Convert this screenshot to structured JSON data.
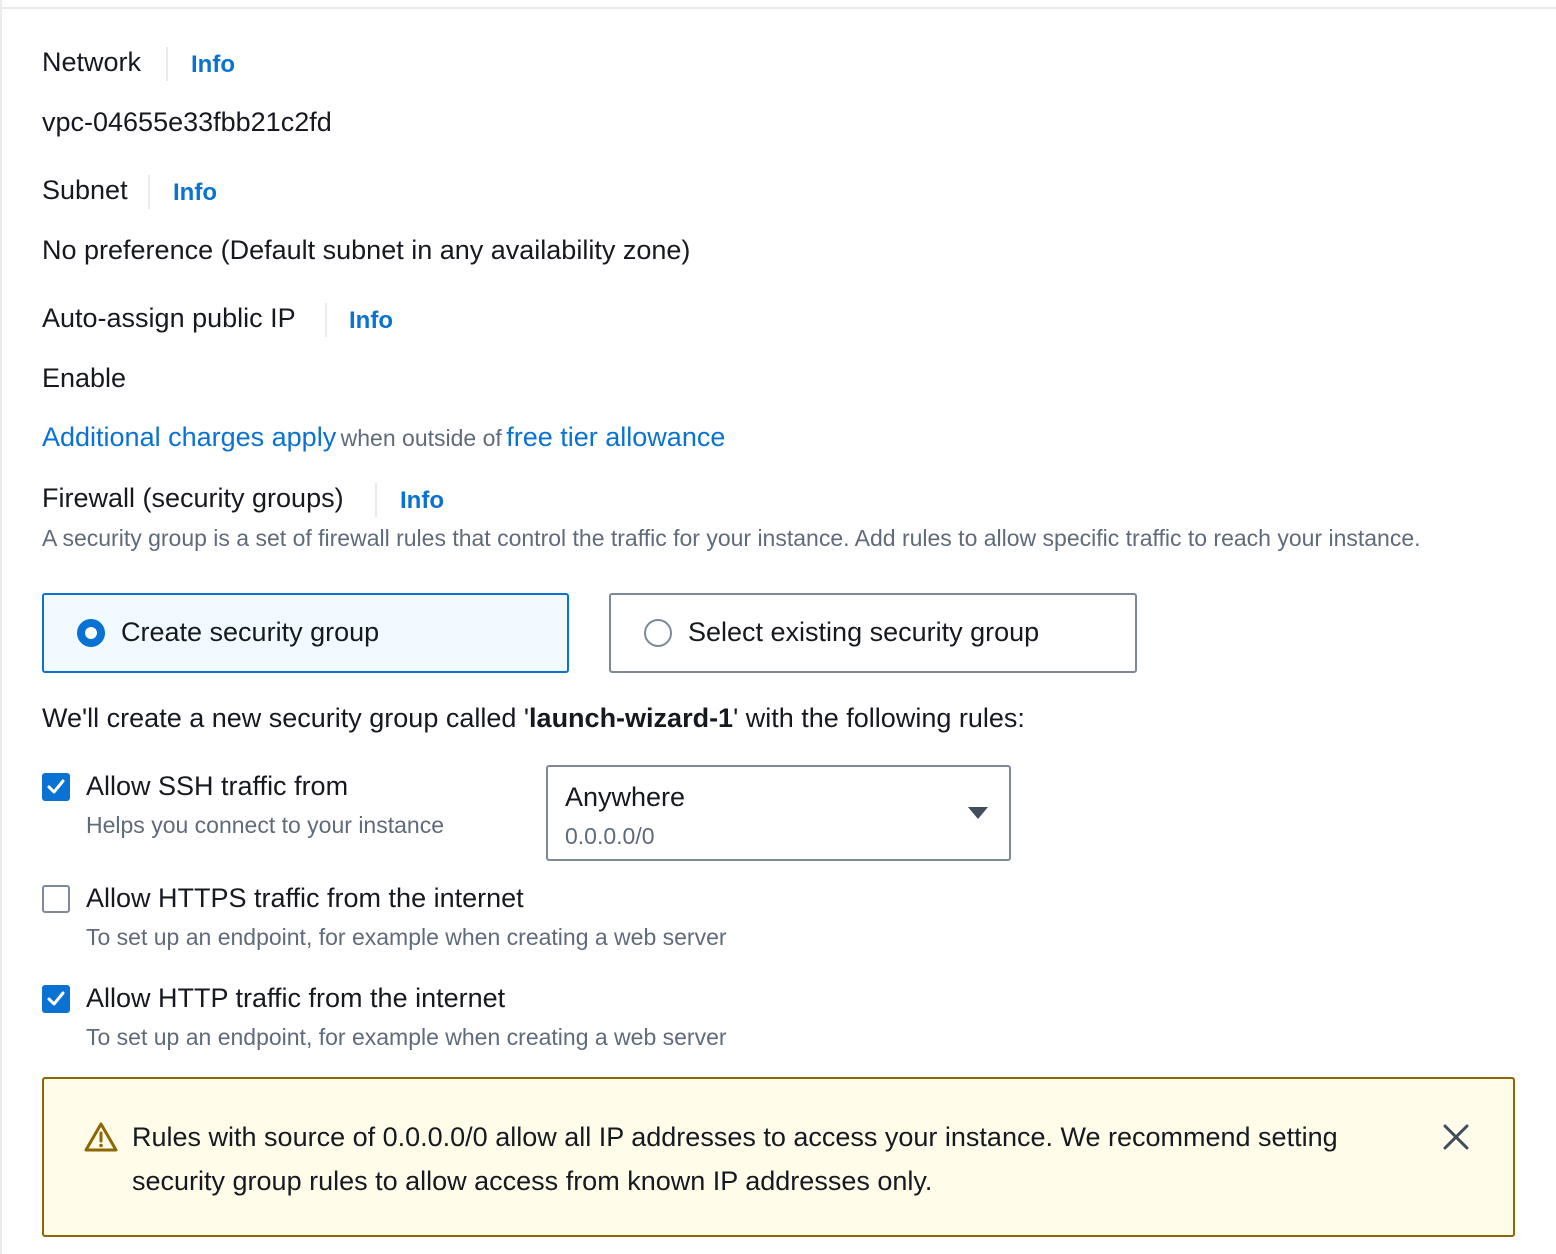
{
  "network": {
    "label": "Network",
    "info": "Info",
    "value": "vpc-04655e33fbb21c2fd"
  },
  "subnet": {
    "label": "Subnet",
    "info": "Info",
    "value": "No preference (Default subnet in any availability zone)"
  },
  "auto_assign": {
    "label": "Auto-assign public IP",
    "info": "Info",
    "value": "Enable"
  },
  "charges": {
    "link1": "Additional charges apply",
    "middle": "when outside of",
    "link2": "free tier allowance"
  },
  "firewall": {
    "label": "Firewall (security groups)",
    "info": "Info",
    "description": "A security group is a set of firewall rules that control the traffic for your instance. Add rules to allow specific traffic to reach your instance.",
    "options": [
      {
        "label": "Create security group",
        "selected": true
      },
      {
        "label": "Select existing security group",
        "selected": false
      }
    ],
    "create_text_prefix": "We'll create a new security group called '",
    "group_name": "launch-wizard-1",
    "create_text_suffix": "' with the following rules:"
  },
  "rules": {
    "ssh": {
      "label": "Allow SSH traffic from",
      "description": "Helps you connect to your instance",
      "checked": true,
      "source": {
        "value": "Anywhere",
        "detail": "0.0.0.0/0"
      }
    },
    "https": {
      "label": "Allow HTTPS traffic from the internet",
      "description": "To set up an endpoint, for example when creating a web server",
      "checked": false
    },
    "http": {
      "label": "Allow HTTP traffic from the internet",
      "description": "To set up an endpoint, for example when creating a web server",
      "checked": true
    }
  },
  "warning": {
    "icon": "warning-icon",
    "text": "Rules with source of 0.0.0.0/0 allow all IP addresses to access your instance. We recommend setting security group rules to allow access from known IP addresses only.",
    "dismiss_icon": "close-icon"
  },
  "colors": {
    "accent": "#0972d3",
    "warning_border": "#8d6605",
    "warning_bg": "#fffce9"
  }
}
